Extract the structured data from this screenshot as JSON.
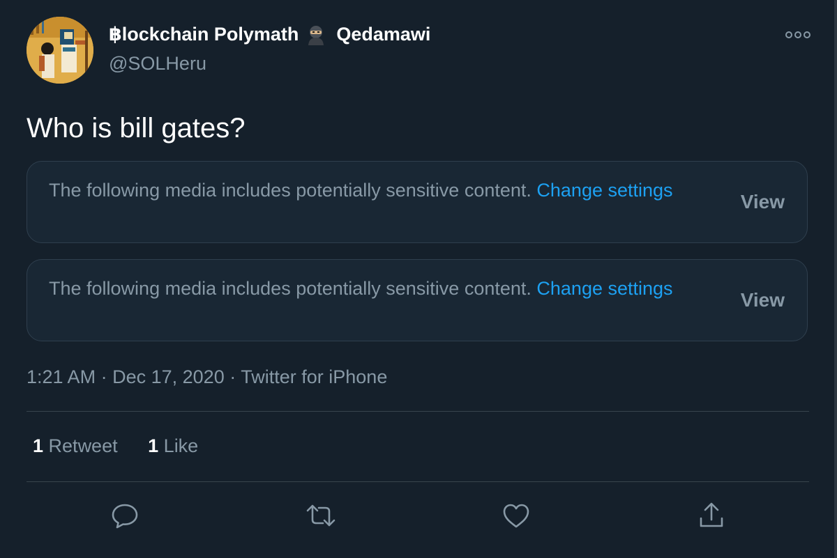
{
  "author": {
    "display_name": "฿lockchain Polymath",
    "display_name_suffix": "Qedamawi",
    "name_emoji": "ninja-emoji",
    "handle": "@SOLHeru"
  },
  "tweet": {
    "text": "Who is bill gates?"
  },
  "media_notices": [
    {
      "message": "The following media includes potentially sensitive content.",
      "link_label": "Change settings",
      "view_label": "View"
    },
    {
      "message": "The following media includes potentially sensitive content.",
      "link_label": "Change settings",
      "view_label": "View"
    }
  ],
  "meta": {
    "time": "1:21 AM",
    "date": "Dec 17, 2020",
    "source": "Twitter for iPhone",
    "separator": "·"
  },
  "stats": {
    "retweets": {
      "count": "1",
      "label": "Retweet"
    },
    "likes": {
      "count": "1",
      "label": "Like"
    }
  },
  "actions": [
    "reply-icon",
    "retweet-icon",
    "like-icon",
    "share-icon"
  ],
  "colors": {
    "background": "#15202b",
    "card": "#192734",
    "text_secondary": "#8899a6",
    "link": "#1da1f2",
    "divider": "#38444d"
  }
}
